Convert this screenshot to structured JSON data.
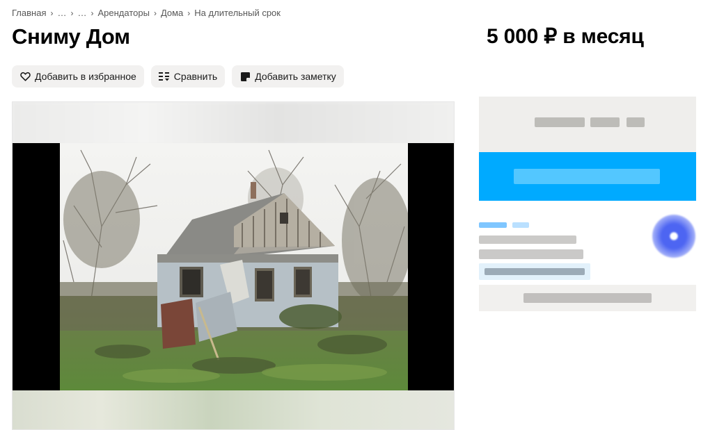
{
  "breadcrumb": {
    "items": [
      "Главная",
      "…",
      "…",
      "Арендаторы",
      "Дома",
      "На длительный срок"
    ],
    "separator": "›"
  },
  "title": "Сниму Дом",
  "price": "5 000 ₽ в месяц",
  "actions": {
    "favorite": "Добавить в избранное",
    "compare": "Сравнить",
    "note": "Добавить заметку"
  },
  "colors": {
    "accent_blue": "#00aaff",
    "button_bg": "#f2f1f0",
    "panel_bg": "#efeeec",
    "avatar_blue": "#4d65f2"
  },
  "icons": {
    "favorite": "heart-icon",
    "compare": "compare-icon",
    "note": "note-icon"
  }
}
